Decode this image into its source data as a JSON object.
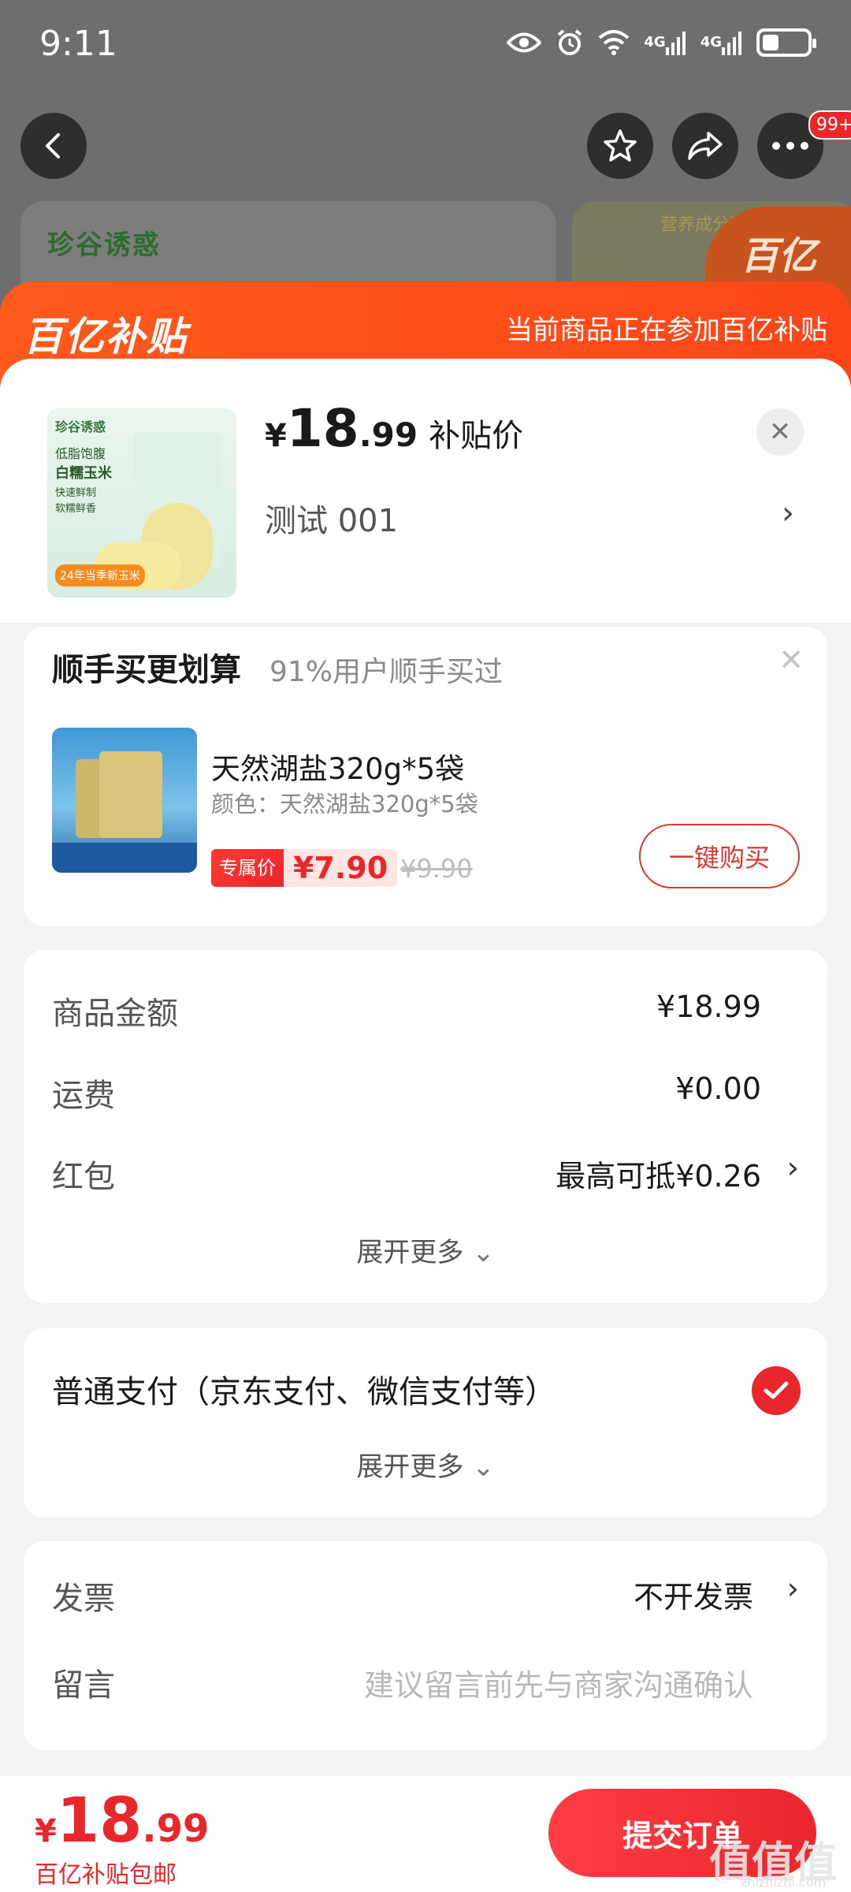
{
  "status_bar": {
    "time": "9:11",
    "network_1": "4G",
    "network_2": "4G"
  },
  "background": {
    "brand": "珍谷诱惑",
    "nutrition_label": "营养成分表",
    "subsidy_tag": "百亿",
    "more_badge": "99+"
  },
  "banner": {
    "logo": "百亿补贴",
    "note": "当前商品正在参加百亿补贴"
  },
  "product": {
    "image_brand": "珍谷诱惑",
    "image_line1": "低脂饱腹",
    "image_line2": "白糯玉米",
    "image_line3": "快速鲜制",
    "image_line4": "软糯鲜香",
    "image_tag": "24年当季新玉米",
    "price_currency": "¥",
    "price_int": "18",
    "price_dec": ".99",
    "price_label": "补贴价",
    "variant": "测试  001"
  },
  "upsell": {
    "title": "顺手买更划算",
    "subtitle": "91%用户顺手买过",
    "item_name": "天然湖盐320g*5袋",
    "item_spec": "颜色：天然湖盐320g*5袋",
    "exclusive_label": "专属价",
    "exclusive_price": "¥7.90",
    "original_price": "¥9.90",
    "buy_button": "一键购买"
  },
  "costs": {
    "goods_label": "商品金额",
    "goods_value": "¥18.99",
    "shipping_label": "运费",
    "shipping_value": "¥0.00",
    "redpacket_label": "红包",
    "redpacket_value": "最高可抵¥0.26",
    "expand": "展开更多"
  },
  "payment": {
    "method": "普通支付（京东支付、微信支付等）",
    "expand": "展开更多"
  },
  "invoice": {
    "invoice_label": "发票",
    "invoice_value": "不开发票",
    "note_label": "留言",
    "note_placeholder": "建议留言前先与商家沟通确认"
  },
  "bottom": {
    "total_currency": "¥",
    "total_int": "18",
    "total_dec": ".99",
    "note": "百亿补贴包邮",
    "submit": "提交订单",
    "watermark": "值值值",
    "watermark_sub": "zhizhizhi.com"
  },
  "colors": {
    "accent": "#e8262b",
    "banner": "#ff5a1c"
  }
}
